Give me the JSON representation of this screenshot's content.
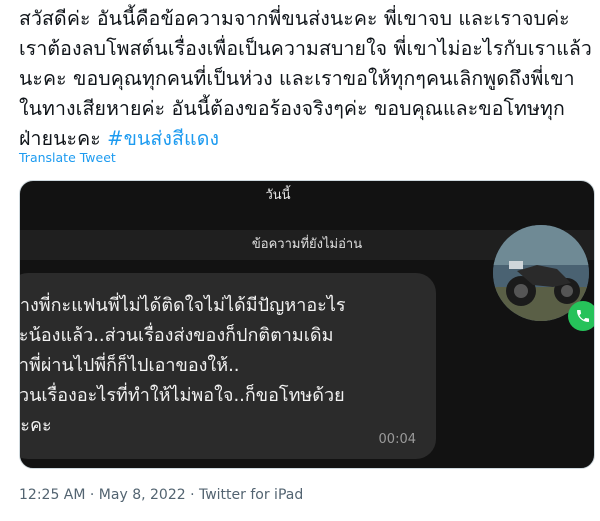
{
  "tweet": {
    "text": "สวัสดีค่ะ อันนี้คือข้อความจากพี่ขนส่งนะคะ พี่เขาจบ และเราจบค่ะ เราต้องลบโพสต์นเรื่องเพื่อเป็นความสบายใจ พี่เขาไม่อะไรกับเราแล้วนะคะ ขอบคุณทุกคนที่เป็นห่วง และเราขอให้ทุกๆคนเลิกพูดถึงพี่เขาในทางเสียหายค่ะ อันนี้ต้องขอร้องจริงๆค่ะ ขอบคุณและขอโทษทุกฝ่ายนะคะ ",
    "hashtag": "#ขนส่งสีแดง",
    "translate_label": "Translate Tweet",
    "timestamp": "12:25 AM · May 8, 2022 · Twitter for iPad"
  },
  "screenshot": {
    "date_label": "วันนี้",
    "unread_label": "ข้อความที่ยังไม่อ่าน",
    "message_text": "ทางพี่กะแฟนพี่ไม่ได้ติดใจไม่ได้มีปัญหาอะไร\nกะน้องแล้ว..ส่วนเรื่องส่งของก็ปกติตามเดิม\nถ้าพี่ผ่านไปพี่ก็ก็ไปเอาของให้..\nส่วนเรื่องอะไรที่ทำให้ไม่พอใจ..ก็ขอโทษด้วย\nนะคะ",
    "message_time": "00:04"
  },
  "colors": {
    "link": "#1d9bf0",
    "call_green": "#26c25a"
  },
  "icons": {
    "call": "phone-icon",
    "avatar": "motorcycle-avatar"
  }
}
